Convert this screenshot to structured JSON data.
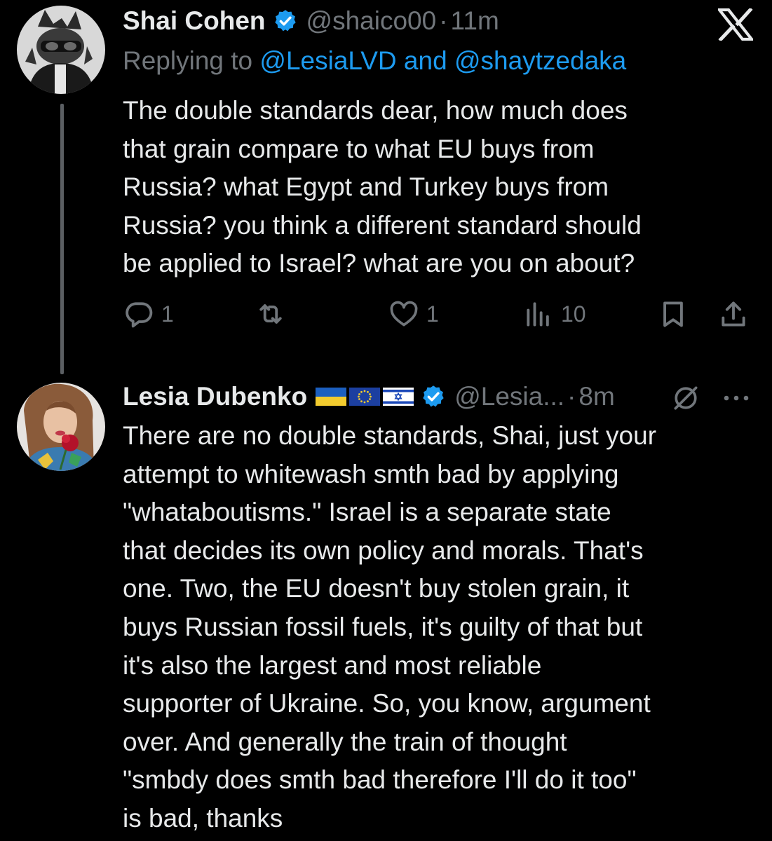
{
  "reply_tweet": {
    "author_name": "Shai Cohen",
    "handle": "@shaico00",
    "separator": "·",
    "time": "11m",
    "replying_prefix": "Replying to",
    "replying_user1": "@LesiaLVD",
    "replying_and": "and",
    "replying_user2": "@shaytzedaka",
    "text_lines": [
      "The double standards dear, how much does",
      "that grain compare to what EU buys from",
      "Russia? what Egypt and Turkey buys from",
      "Russia? you think a different standard should",
      "be applied to Israel? what are you on about?"
    ],
    "reply_count": "1",
    "retweet_count": "",
    "like_count": "1",
    "view_count": "10"
  },
  "main_tweet": {
    "author_name": "Lesia Dubenko",
    "flags": [
      "ukraine-flag-icon",
      "eu-flag-icon",
      "israel-flag-icon"
    ],
    "handle": "@Lesia...",
    "separator": "·",
    "time": "8m",
    "text_lines": [
      "There are no double standards, Shai, just your",
      "attempt to whitewash smth bad by applying",
      "\"whataboutisms.\" Israel is a separate state",
      "that decides its own policy and morals. That's",
      "one. Two, the EU doesn't buy stolen grain, it",
      "buys Russian fossil fuels, it's guilty of that but",
      "it's also the largest and most reliable",
      "supporter of Ukraine. So, you know, argument",
      "over. And generally the train of thought",
      "\"smbdy does smth bad therefore I'll do it too\"",
      "is bad, thanks"
    ]
  },
  "colors": {
    "background": "#000000",
    "text_primary": "#e7e9ea",
    "text_secondary": "#71767b",
    "link": "#1d9bf0",
    "verified": "#1d9bf0"
  },
  "icons": [
    "x-logo-icon",
    "verified-badge-icon",
    "reply-icon",
    "retweet-icon",
    "like-icon",
    "views-icon",
    "bookmark-icon",
    "share-icon",
    "muted-icon",
    "more-icon"
  ]
}
